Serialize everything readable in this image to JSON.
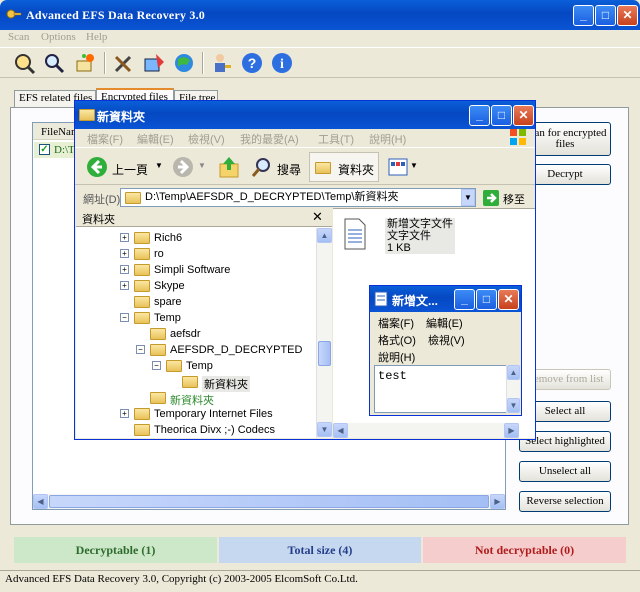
{
  "app": {
    "title": "Advanced EFS Data Recovery 3.0",
    "menu": [
      "Scan",
      "Options",
      "Help"
    ],
    "toolbar_icons": [
      "scan-icon",
      "search-icon",
      "wizard-icon",
      "tools-icon",
      "decrypt-icon",
      "globe-icon",
      "user-key-icon",
      "help-icon",
      "info-icon"
    ]
  },
  "tabs": [
    "EFS related files",
    "Encrypted files",
    "File tree"
  ],
  "list": {
    "column": "FileNam",
    "row_prefix": "D:\\T"
  },
  "buttons": {
    "scan": "Scan for encrypted files",
    "decrypt": "Decrypt",
    "remove": "Remove from list",
    "select_all": "Select all",
    "select_highlighted": "Select highlighted",
    "unselect_all": "Unselect all",
    "reverse": "Reverse selection"
  },
  "status": {
    "decryptable": "Decryptable (1)",
    "total": "Total size (4)",
    "not_decryptable": "Not decryptable (0)",
    "copyright": "Advanced EFS Data Recovery 3.0, Copyright (c) 2003-2005 ElcomSoft Co.Ltd."
  },
  "explorer": {
    "title": "新資料夾",
    "menu": [
      "檔案(F)",
      "編輯(E)",
      "檢視(V)",
      "我的最愛(A)",
      "工具(T)",
      "說明(H)"
    ],
    "back_label": "上一頁",
    "search_label": "搜尋",
    "folders_label": "資料夾",
    "address_label": "網址(D)",
    "address": "D:\\Temp\\AEFSDR_D_DECRYPTED\\Temp\\新資料夾",
    "go_label": "移至",
    "folders_pane_title": "資料夾",
    "tree": [
      {
        "label": "Rich6",
        "expander": "+"
      },
      {
        "label": "ro",
        "expander": "+"
      },
      {
        "label": "Simpli Software",
        "expander": "+"
      },
      {
        "label": "Skype",
        "expander": "+"
      },
      {
        "label": "spare",
        "expander": ""
      },
      {
        "label": "Temp",
        "expander": "-"
      },
      {
        "label": "aefsdr",
        "expander": ""
      },
      {
        "label": "AEFSDR_D_DECRYPTED",
        "expander": "-"
      },
      {
        "label": "Temp",
        "expander": "-"
      },
      {
        "label": "新資料夾",
        "expander": ""
      },
      {
        "label": "新資料夾",
        "expander": ""
      },
      {
        "label": "Temporary Internet Files",
        "expander": "+"
      },
      {
        "label": "Theorica Divx ;-) Codecs",
        "expander": ""
      }
    ],
    "file": {
      "name": "新增文字文件",
      "type": "文字文件",
      "size": "1 KB"
    }
  },
  "notepad": {
    "title": "新增文...",
    "menu": [
      "檔案(F)",
      "編輯(E)",
      "格式(O)",
      "檢視(V)",
      "說明(H)"
    ],
    "content": "test"
  }
}
